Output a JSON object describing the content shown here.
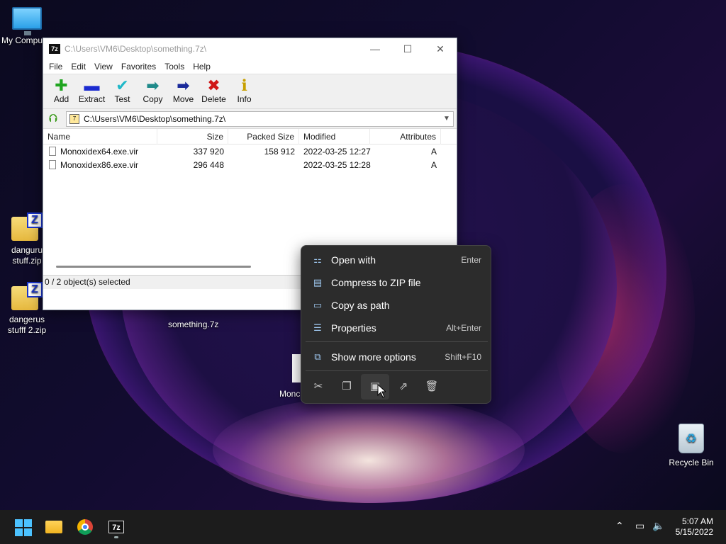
{
  "desktop": {
    "icons": [
      {
        "label": "My Compu"
      },
      {
        "label_line1": "danguru",
        "label_line2": "stuff.zip"
      },
      {
        "label_line1": "dangerus",
        "label_line2": "stufff 2.zip"
      },
      {
        "label": "Recycle Bin"
      }
    ],
    "file_label": "something.7z",
    "partial_label": "Monc"
  },
  "window": {
    "title": "C:\\Users\\VM6\\Desktop\\something.7z\\",
    "app_icon": "7z",
    "controls": {
      "minimize": "—",
      "maximize": "☐",
      "close": "✕"
    },
    "menu": [
      "File",
      "Edit",
      "View",
      "Favorites",
      "Tools",
      "Help"
    ],
    "toolbar": [
      {
        "label": "Add",
        "icon": "plus-icon",
        "glyph": "✚",
        "color": "#1fa51f"
      },
      {
        "label": "Extract",
        "icon": "minus-icon",
        "glyph": "▬",
        "color": "#1b2bd0"
      },
      {
        "label": "Test",
        "icon": "check-icon",
        "glyph": "✔",
        "color": "#20b8c8"
      },
      {
        "label": "Copy",
        "icon": "copy-arrow-icon",
        "glyph": "➡",
        "color": "#1f8a8a"
      },
      {
        "label": "Move",
        "icon": "move-arrow-icon",
        "glyph": "➡",
        "color": "#1a2a9a"
      },
      {
        "label": "Delete",
        "icon": "delete-x-icon",
        "glyph": "✖",
        "color": "#d01818"
      },
      {
        "label": "Info",
        "icon": "info-icon",
        "glyph": "ℹ",
        "color": "#c8a000"
      }
    ],
    "address": "C:\\Users\\VM6\\Desktop\\something.7z\\",
    "columns": [
      "Name",
      "Size",
      "Packed Size",
      "Modified",
      "Attributes"
    ],
    "files": [
      {
        "name": "Monoxidex64.exe.vir",
        "size": "337 920",
        "packed": "158 912",
        "modified": "2022-03-25 12:27",
        "attr": "A"
      },
      {
        "name": "Monoxidex86.exe.vir",
        "size": "296 448",
        "packed": "",
        "modified": "2022-03-25 12:28",
        "attr": "A"
      }
    ],
    "status": "0 / 2 object(s) selected"
  },
  "context_menu": {
    "items": [
      {
        "label": "Open with",
        "shortcut": "Enter",
        "icon": "open-with-icon"
      },
      {
        "label": "Compress to ZIP file",
        "shortcut": "",
        "icon": "zip-icon"
      },
      {
        "label": "Copy as path",
        "shortcut": "",
        "icon": "copy-path-icon"
      },
      {
        "label": "Properties",
        "shortcut": "Alt+Enter",
        "icon": "properties-icon"
      },
      {
        "label": "Show more options",
        "shortcut": "Shift+F10",
        "icon": "more-options-icon"
      }
    ],
    "actions": [
      "cut-icon",
      "copy-icon",
      "rename-icon",
      "share-icon",
      "delete-icon"
    ]
  },
  "taskbar": {
    "apps": [
      "start-icon",
      "file-explorer-icon",
      "chrome-icon",
      "7zip-icon"
    ],
    "time": "5:07 AM",
    "date": "5/15/2022"
  },
  "colors": {
    "context_bg": "#2c2c2c",
    "taskbar_bg": "#1c1c1c",
    "accent": "#4cc2ff"
  }
}
